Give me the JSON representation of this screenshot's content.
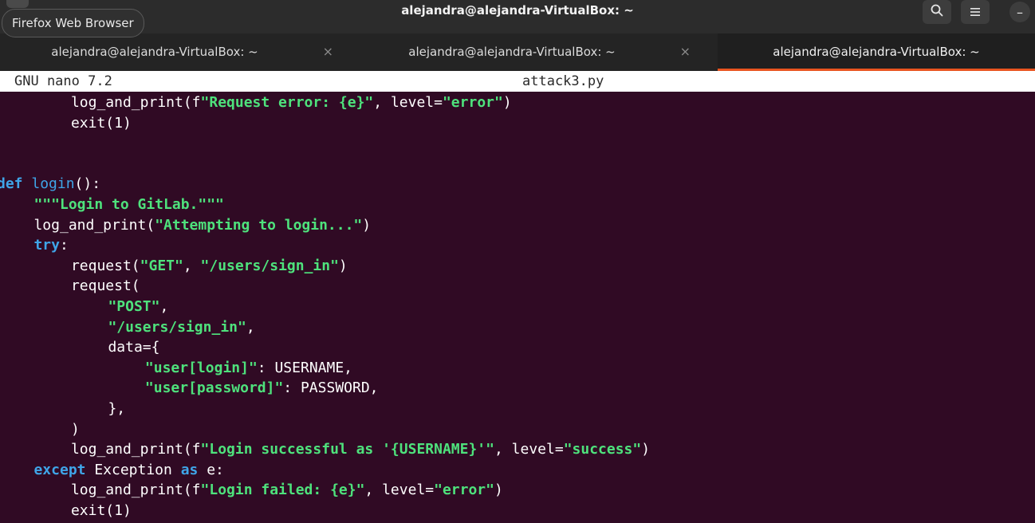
{
  "window": {
    "title": "alejandra@alejandra-VirtualBox: ~",
    "tooltip": "Firefox Web Browser",
    "buttons": {
      "search_icon": "search-icon",
      "menu_icon": "hamburger-menu-icon",
      "minimize_label": "–"
    }
  },
  "tabs": [
    {
      "label": "alejandra@alejandra-VirtualBox: ~",
      "close": "×",
      "active": false
    },
    {
      "label": "alejandra@alejandra-VirtualBox: ~",
      "close": "×",
      "active": false
    },
    {
      "label": "alejandra@alejandra-VirtualBox: ~",
      "close": "",
      "active": true
    }
  ],
  "nano": {
    "version": "GNU nano 7.2",
    "filename": "attack3.py"
  },
  "colors": {
    "terminal_bg": "#300a24",
    "string": "#4ee27c",
    "keyword": "#3fa5e8",
    "active_tab_accent": "#e95420"
  },
  "code_lines": [
    {
      "indent": 8,
      "tokens": [
        {
          "t": "log_and_print(f",
          "c": "plain"
        },
        {
          "t": "\"Request error: {e}\"",
          "c": "str"
        },
        {
          "t": ", level=",
          "c": "plain"
        },
        {
          "t": "\"error\"",
          "c": "str"
        },
        {
          "t": ")",
          "c": "plain"
        }
      ]
    },
    {
      "indent": 8,
      "tokens": [
        {
          "t": "exit(1)",
          "c": "plain"
        }
      ]
    },
    {
      "indent": 0,
      "tokens": []
    },
    {
      "indent": 0,
      "tokens": []
    },
    {
      "indent": 0,
      "tokens": [
        {
          "t": "def ",
          "c": "kw"
        },
        {
          "t": "login",
          "c": "fn"
        },
        {
          "t": "():",
          "c": "plain"
        }
      ]
    },
    {
      "indent": 4,
      "tokens": [
        {
          "t": "\"\"\"Login to GitLab.\"\"\"",
          "c": "str"
        }
      ]
    },
    {
      "indent": 4,
      "tokens": [
        {
          "t": "log_and_print(",
          "c": "plain"
        },
        {
          "t": "\"Attempting to login...\"",
          "c": "str"
        },
        {
          "t": ")",
          "c": "plain"
        }
      ]
    },
    {
      "indent": 4,
      "tokens": [
        {
          "t": "try",
          "c": "kw"
        },
        {
          "t": ":",
          "c": "plain"
        }
      ]
    },
    {
      "indent": 8,
      "tokens": [
        {
          "t": "request(",
          "c": "plain"
        },
        {
          "t": "\"GET\"",
          "c": "str"
        },
        {
          "t": ", ",
          "c": "plain"
        },
        {
          "t": "\"/users/sign_in\"",
          "c": "str"
        },
        {
          "t": ")",
          "c": "plain"
        }
      ]
    },
    {
      "indent": 8,
      "tokens": [
        {
          "t": "request(",
          "c": "plain"
        }
      ]
    },
    {
      "indent": 12,
      "tokens": [
        {
          "t": "\"POST\"",
          "c": "str"
        },
        {
          "t": ",",
          "c": "plain"
        }
      ]
    },
    {
      "indent": 12,
      "tokens": [
        {
          "t": "\"/users/sign_in\"",
          "c": "str"
        },
        {
          "t": ",",
          "c": "plain"
        }
      ]
    },
    {
      "indent": 12,
      "tokens": [
        {
          "t": "data={",
          "c": "plain"
        }
      ]
    },
    {
      "indent": 16,
      "tokens": [
        {
          "t": "\"user[login]\"",
          "c": "str"
        },
        {
          "t": ": USERNAME,",
          "c": "plain"
        }
      ]
    },
    {
      "indent": 16,
      "tokens": [
        {
          "t": "\"user[password]\"",
          "c": "str"
        },
        {
          "t": ": PASSWORD,",
          "c": "plain"
        }
      ]
    },
    {
      "indent": 12,
      "tokens": [
        {
          "t": "},",
          "c": "plain"
        }
      ]
    },
    {
      "indent": 8,
      "tokens": [
        {
          "t": ")",
          "c": "plain"
        }
      ]
    },
    {
      "indent": 8,
      "tokens": [
        {
          "t": "log_and_print(f",
          "c": "plain"
        },
        {
          "t": "\"Login successful as '{USERNAME}'\"",
          "c": "str"
        },
        {
          "t": ", level=",
          "c": "plain"
        },
        {
          "t": "\"success\"",
          "c": "str"
        },
        {
          "t": ")",
          "c": "plain"
        }
      ]
    },
    {
      "indent": 4,
      "tokens": [
        {
          "t": "except ",
          "c": "kw"
        },
        {
          "t": "Exception ",
          "c": "plain"
        },
        {
          "t": "as ",
          "c": "kw"
        },
        {
          "t": "e:",
          "c": "plain"
        }
      ]
    },
    {
      "indent": 8,
      "tokens": [
        {
          "t": "log_and_print(f",
          "c": "plain"
        },
        {
          "t": "\"Login failed: {e}\"",
          "c": "str"
        },
        {
          "t": ", level=",
          "c": "plain"
        },
        {
          "t": "\"error\"",
          "c": "str"
        },
        {
          "t": ")",
          "c": "plain"
        }
      ]
    },
    {
      "indent": 8,
      "tokens": [
        {
          "t": "exit(1)",
          "c": "plain"
        }
      ]
    }
  ]
}
